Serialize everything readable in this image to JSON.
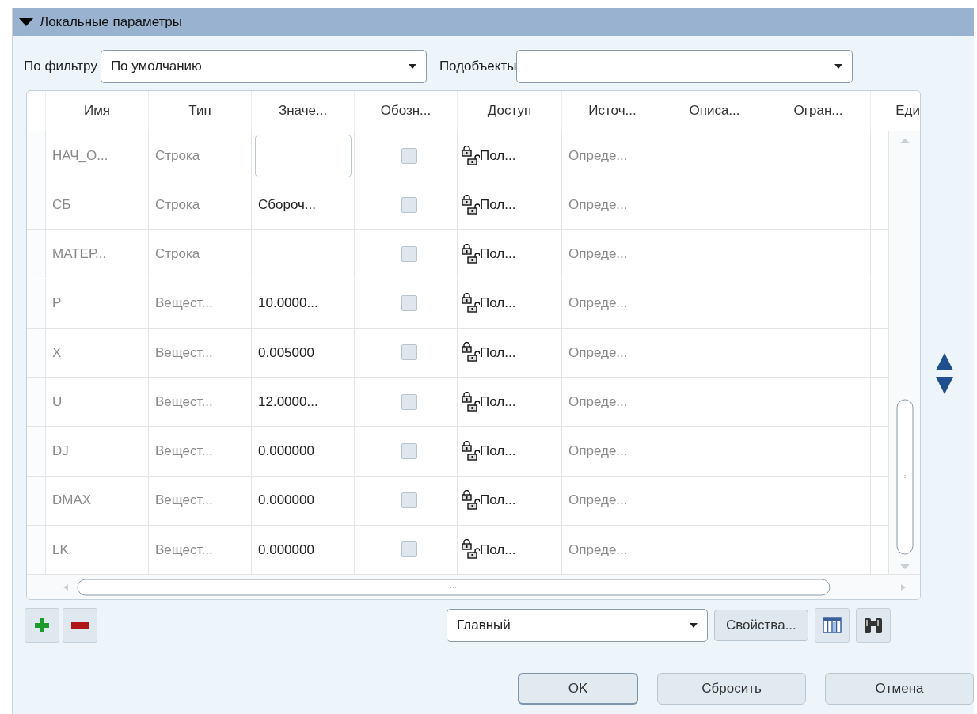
{
  "section": {
    "title": "Локальные параметры",
    "expanded": true
  },
  "filter": {
    "label": "По фильтру",
    "value": "По умолчанию"
  },
  "subobjects": {
    "label": "Подобъекты"
  },
  "table": {
    "columns": [
      "Имя",
      "Тип",
      "Значе...",
      "Обозн...",
      "Доступ",
      "Источ...",
      "Описа...",
      "Огран...",
      "Еди"
    ],
    "rows": [
      {
        "name": "НАЧ_О...",
        "type": "Строка",
        "kind": "edit",
        "checked": false,
        "access": "Пол...",
        "source": "Опреде..."
      },
      {
        "name": "СБ",
        "type": "Строка",
        "kind": "text",
        "value": "Сбороч...",
        "checked": false,
        "access": "Пол...",
        "source": "Опреде..."
      },
      {
        "name": "МАТЕР...",
        "type": "Строка",
        "kind": "text",
        "checked": false,
        "access": "Пол...",
        "source": "Опреде..."
      },
      {
        "name": "P",
        "type": "Вещест...",
        "kind": "text",
        "value": "10.0000...",
        "checked": false,
        "access": "Пол...",
        "source": "Опреде..."
      },
      {
        "name": "X",
        "type": "Вещест...",
        "kind": "text",
        "value": "0.005000",
        "checked": false,
        "access": "Пол...",
        "source": "Опреде..."
      },
      {
        "name": "U",
        "type": "Вещест...",
        "kind": "text",
        "value": "12.0000...",
        "checked": false,
        "access": "Пол...",
        "source": "Опреде..."
      },
      {
        "name": "DJ",
        "type": "Вещест...",
        "kind": "text",
        "value": "0.000000",
        "checked": false,
        "access": "Пол...",
        "source": "Опреде..."
      },
      {
        "name": "DMAX",
        "type": "Вещест...",
        "kind": "text",
        "value": "0.000000",
        "checked": false,
        "access": "Пол...",
        "source": "Опреде..."
      },
      {
        "name": "LK",
        "type": "Вещест...",
        "kind": "text",
        "value": "0.000000",
        "checked": false,
        "access": "Пол...",
        "source": "Опреде..."
      }
    ]
  },
  "toolbar": {
    "view": "Главный",
    "properties": "Свойства..."
  },
  "buttons": [
    {
      "label": "OK",
      "default": true
    },
    {
      "label": "Сбросить",
      "default": false
    },
    {
      "label": "Отмена",
      "default": false
    }
  ]
}
